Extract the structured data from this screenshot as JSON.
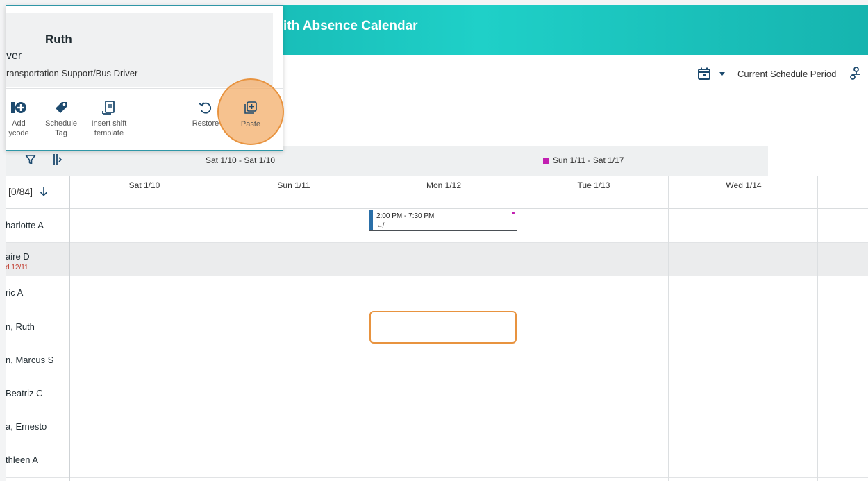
{
  "banner": {
    "title": "ith Absence Calendar"
  },
  "toolbar": {
    "period_label": "Current Schedule Period"
  },
  "popup": {
    "employee_name": "Ruth",
    "job_short": "ver",
    "job_full": "ransportation Support/Bus Driver",
    "actions": [
      {
        "label_line1": "Add",
        "label_line2": "ycode",
        "icon": "add-paycode-icon"
      },
      {
        "label_line1": "Schedule",
        "label_line2": "Tag",
        "icon": "tag-icon"
      },
      {
        "label_line1": "Insert shift",
        "label_line2": "template",
        "icon": "insert-template-icon"
      },
      {
        "label_line1": "Restore",
        "label_line2": "",
        "icon": "restore-icon"
      },
      {
        "label_line1": "Paste",
        "label_line2": "",
        "icon": "paste-icon"
      }
    ]
  },
  "grid": {
    "group_headers": [
      {
        "label": "Sat 1/10 - Sat 1/10"
      },
      {
        "label": "Sun 1/11 - Sat 1/17",
        "marker_color": "#c21fb1"
      }
    ],
    "count_label": "[0/84]",
    "days": [
      "Sat 1/10",
      "Sun 1/11",
      "Mon 1/12",
      "Tue 1/13",
      "Wed 1/14"
    ],
    "employees": [
      {
        "name": "harlotte A",
        "sub": ""
      },
      {
        "name": "aire D",
        "sub": "d 12/11"
      },
      {
        "name": "ric A",
        "sub": ""
      },
      {
        "name": "n, Ruth",
        "sub": ""
      },
      {
        "name": "n, Marcus S",
        "sub": ""
      },
      {
        "name": "Beatriz C",
        "sub": ""
      },
      {
        "name": "a, Ernesto",
        "sub": ""
      },
      {
        "name": "thleen A",
        "sub": ""
      }
    ],
    "shift": {
      "time": "2:00 PM - 7:30 PM",
      "symbol": "⇎"
    }
  }
}
